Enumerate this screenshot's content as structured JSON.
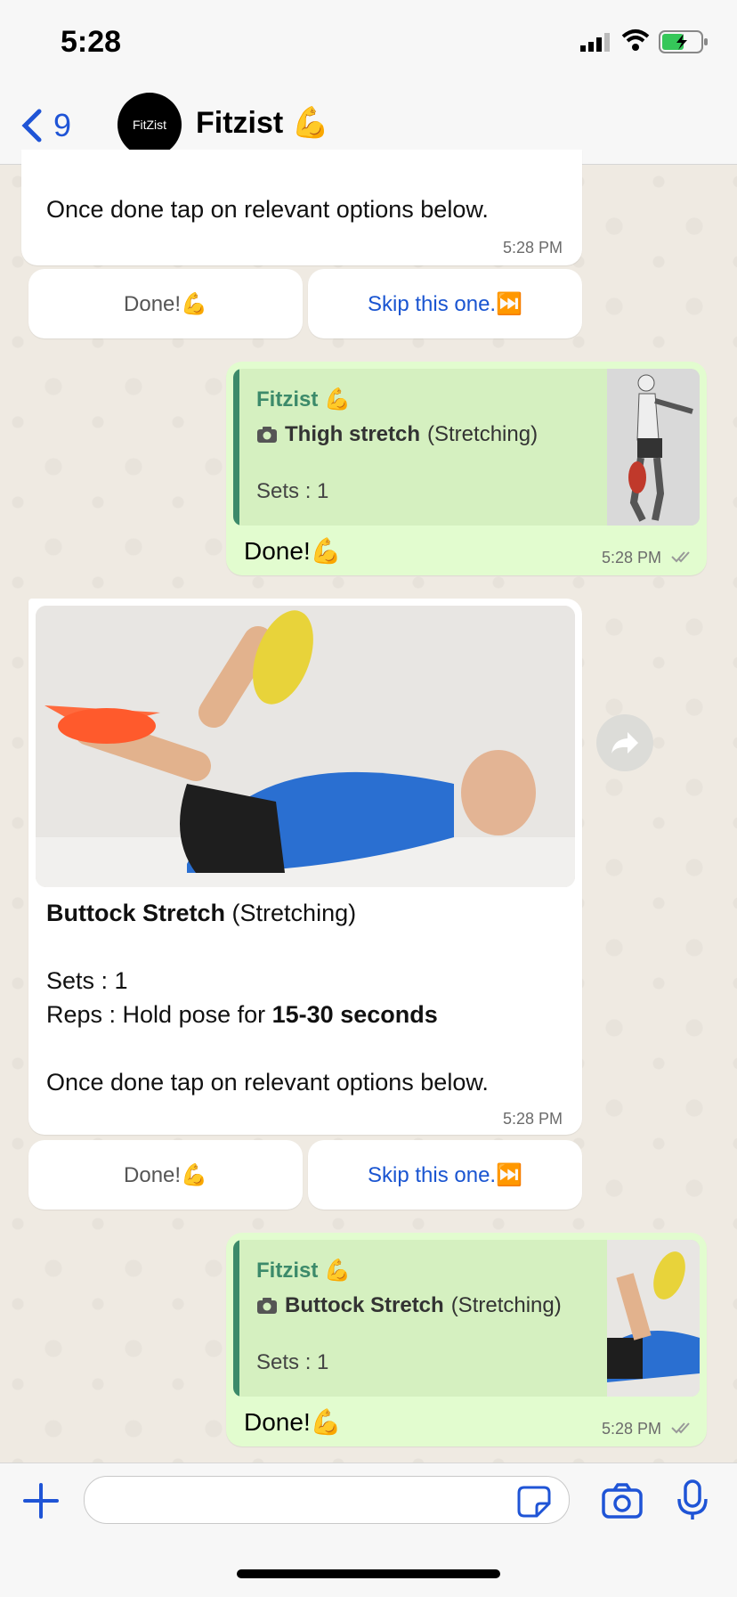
{
  "status_bar": {
    "time": "5:28"
  },
  "header": {
    "back_count": "9",
    "chat_name": "Fitzist 💪",
    "avatar_text": "FitZist"
  },
  "messages": {
    "m1": {
      "text": "Once done tap on relevant options below.",
      "time": "5:28 PM",
      "done_label": "Done!💪",
      "skip_label": "Skip this one.⏭️"
    },
    "m2": {
      "quote_name": "Fitzist 💪",
      "quote_title_bold": "Thigh stretch",
      "quote_title_rest": "(Stretching)",
      "quote_sets": "Sets : 1",
      "text": "Done!💪",
      "time": "5:28 PM"
    },
    "m3": {
      "title_bold": "Buttock Stretch",
      "title_rest": "(Stretching)",
      "sets": "Sets : 1",
      "reps_prefix": "Reps : Hold pose for ",
      "reps_bold": "15-30 seconds",
      "instruction": "Once done tap on relevant options below.",
      "time": "5:28 PM",
      "done_label": "Done!💪",
      "skip_label": "Skip this one.⏭️"
    },
    "m4": {
      "quote_name": "Fitzist 💪",
      "quote_title_bold": "Buttock Stretch",
      "quote_title_rest": "(Stretching)",
      "quote_sets": "Sets : 1",
      "text": "Done!💪",
      "time": "5:28 PM"
    }
  },
  "composer": {
    "placeholder": ""
  },
  "colors": {
    "accent": "#1f54d6",
    "outgoing": "#e2fccf",
    "quote": "#d5f0c0",
    "quote_name": "#3c8a6a"
  }
}
